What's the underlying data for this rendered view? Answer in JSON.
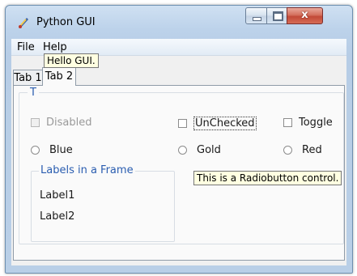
{
  "window": {
    "title": "Python GUI",
    "close_glyph": "x"
  },
  "menubar": {
    "items": [
      "File",
      "Help"
    ]
  },
  "tabs": [
    {
      "label": "Tab 1",
      "selected": false
    },
    {
      "label": "Tab 2",
      "selected": true
    }
  ],
  "group": {
    "title": "T"
  },
  "checkboxes": [
    {
      "label": "Disabled",
      "checked": false,
      "disabled": true
    },
    {
      "label": "UnChecked",
      "checked": false,
      "disabled": false,
      "focused": true
    },
    {
      "label": "Toggle",
      "checked": false,
      "disabled": false
    }
  ],
  "radios": [
    {
      "label": "Blue",
      "selected": false
    },
    {
      "label": "Gold",
      "selected": false
    },
    {
      "label": "Red",
      "selected": false
    }
  ],
  "label_frame": {
    "title": "Labels in a Frame",
    "labels": [
      "Label1",
      "Label2"
    ]
  },
  "tooltips": {
    "hello": "Hello GUI.",
    "radio": "This is a Radiobutton control."
  },
  "colors": {
    "accent_text": "#2a5db0",
    "tooltip_bg": "#ffffe1",
    "close_button": "#c24a37"
  }
}
